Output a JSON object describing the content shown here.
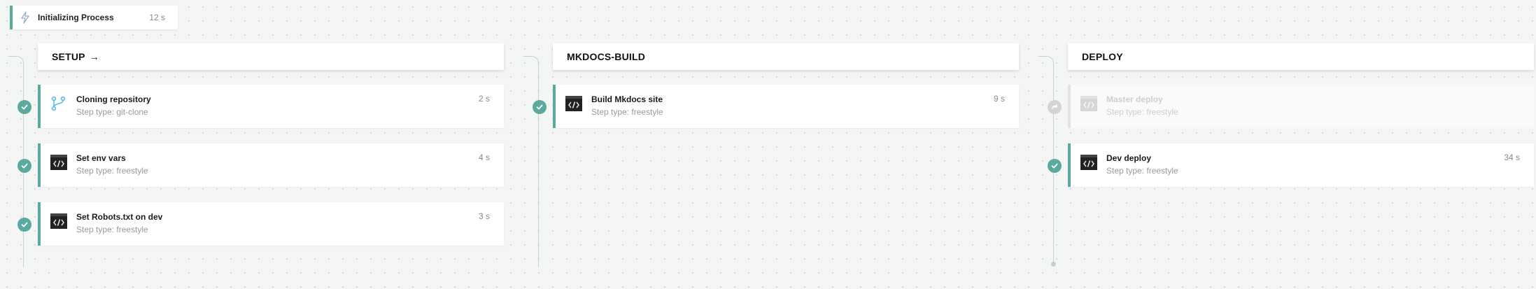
{
  "init": {
    "title": "Initializing Process",
    "duration": "12 s"
  },
  "colors": {
    "success": "#5aaa9f",
    "skipped": "#d4d4d4",
    "line": "#c9cfcc"
  },
  "stages": [
    {
      "name": "SETUP",
      "arrow": "→",
      "steps": [
        {
          "name": "Cloning repository",
          "type": "Step type: git-clone",
          "duration": "2 s",
          "icon": "git-branch-icon",
          "status": "success"
        },
        {
          "name": "Set env vars",
          "type": "Step type: freestyle",
          "duration": "4 s",
          "icon": "terminal-code-icon",
          "status": "success"
        },
        {
          "name": "Set Robots.txt on dev",
          "type": "Step type: freestyle",
          "duration": "3 s",
          "icon": "terminal-code-icon",
          "status": "success"
        }
      ]
    },
    {
      "name": "MKDOCS-BUILD",
      "steps": [
        {
          "name": "Build Mkdocs site",
          "type": "Step type: freestyle",
          "duration": "9 s",
          "icon": "terminal-code-icon",
          "status": "success"
        }
      ]
    },
    {
      "name": "DEPLOY",
      "steps": [
        {
          "name": "Master deploy",
          "type": "Step type: freestyle",
          "duration": "",
          "icon": "terminal-code-icon",
          "status": "skipped"
        },
        {
          "name": "Dev deploy",
          "type": "Step type: freestyle",
          "duration": "34 s",
          "icon": "terminal-code-icon",
          "status": "success"
        }
      ]
    }
  ]
}
